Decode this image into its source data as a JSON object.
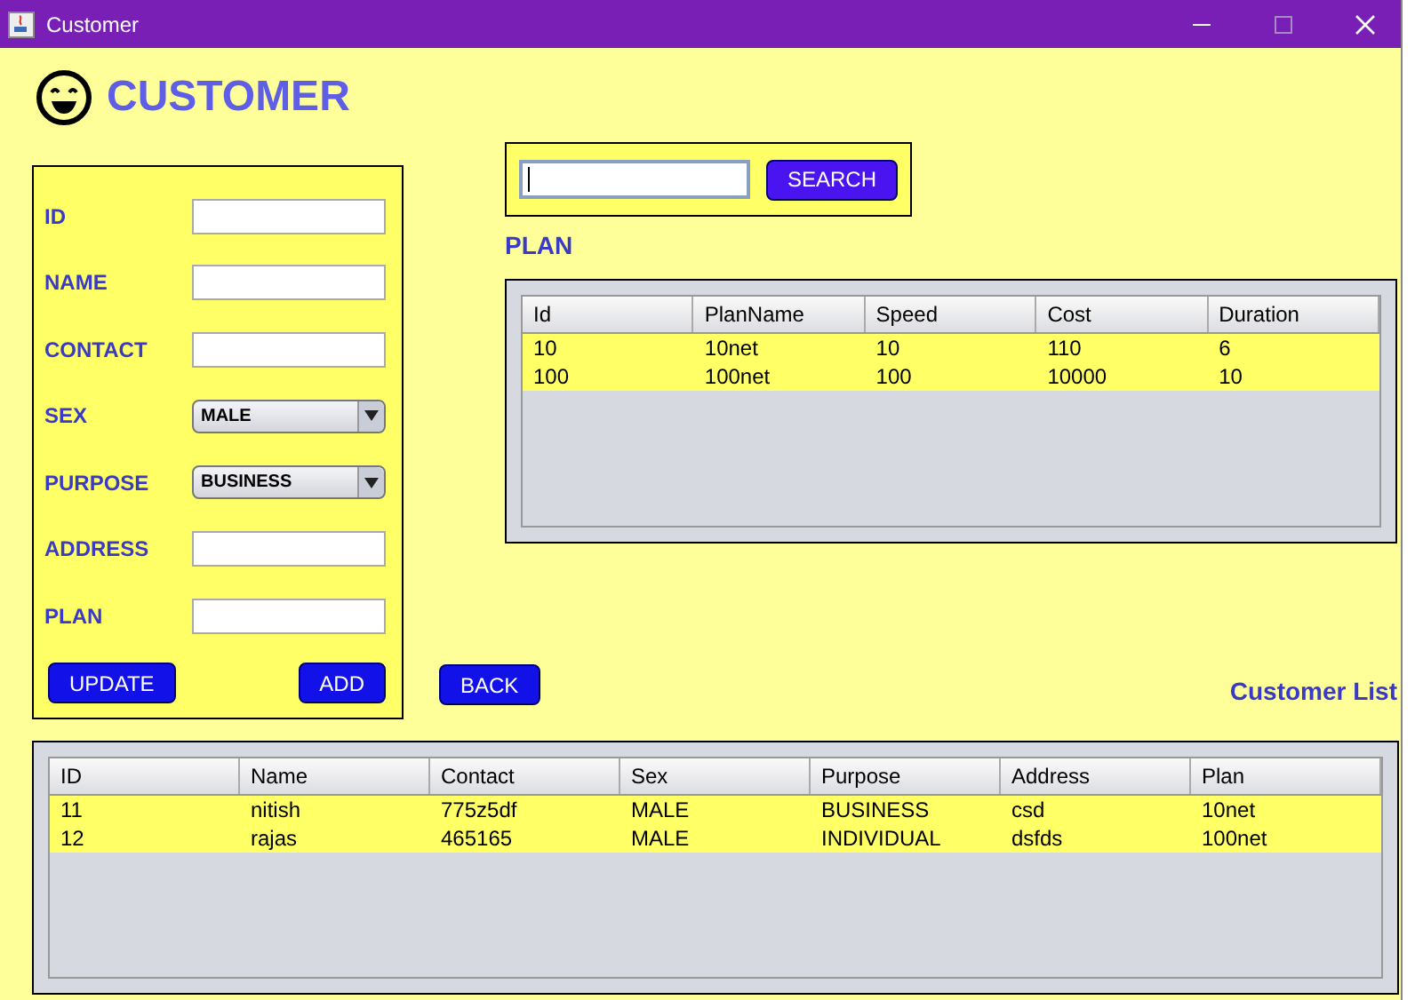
{
  "window": {
    "title": "Customer"
  },
  "heading": "CUSTOMER",
  "form": {
    "fields": [
      {
        "label": "ID",
        "kind": "text"
      },
      {
        "label": "NAME",
        "kind": "text"
      },
      {
        "label": "CONTACT",
        "kind": "text"
      },
      {
        "label": "SEX",
        "kind": "combo",
        "value": "MALE"
      },
      {
        "label": "PURPOSE",
        "kind": "combo",
        "value": "BUSINESS"
      },
      {
        "label": "ADDRESS",
        "kind": "text"
      },
      {
        "label": "PLAN",
        "kind": "text"
      }
    ],
    "buttons": [
      "UPDATE",
      "ADD"
    ]
  },
  "search": {
    "button": "SEARCH"
  },
  "plan": {
    "label": "PLAN",
    "columns": [
      "Id",
      "PlanName",
      "Speed",
      "Cost",
      "Duration"
    ],
    "rows": [
      [
        "10",
        "10net",
        "10",
        "110",
        "6"
      ],
      [
        "100",
        "100net",
        "100",
        "10000",
        "10"
      ]
    ]
  },
  "back_button": "BACK",
  "customer_list": {
    "label": "Customer List",
    "columns": [
      "ID",
      "Name",
      "Contact",
      "Sex",
      "Purpose",
      "Address",
      "Plan"
    ],
    "rows": [
      [
        "11",
        "nitish",
        "775z5df",
        "MALE",
        "BUSINESS",
        "csd",
        "10net"
      ],
      [
        "12",
        "rajas",
        "465165",
        "MALE",
        "INDIVIDUAL",
        "dsfds",
        "100net"
      ]
    ]
  }
}
